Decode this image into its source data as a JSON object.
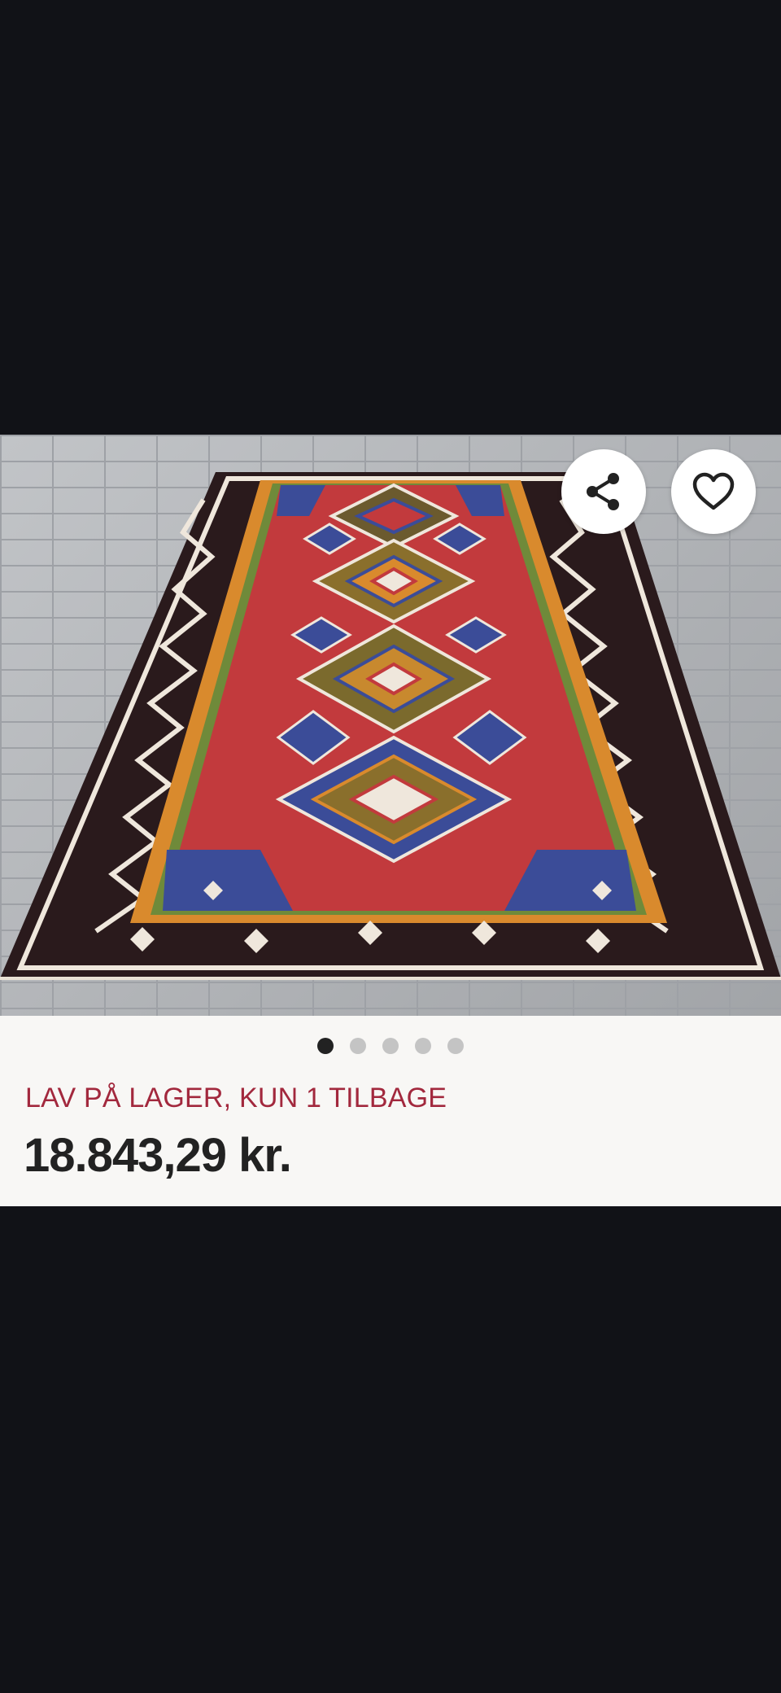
{
  "product": {
    "image_alt": "Kelim tæppe",
    "gallery": {
      "count": 5,
      "active_index": 0
    },
    "stock_notice": "LAV PÅ LAGER, KUN 1 TILBAGE",
    "price": "18.843,29 kr."
  },
  "actions": {
    "share_icon": "share-icon",
    "favorite_icon": "heart-outline-icon"
  },
  "colors": {
    "backdrop": "#111217",
    "panel": "#f8f7f5",
    "stock_notice": "#a2283d",
    "price": "#222222",
    "dot_active": "#222222",
    "dot_inactive": "#c4c4c4"
  }
}
